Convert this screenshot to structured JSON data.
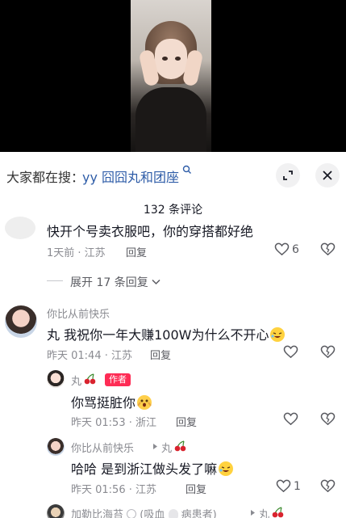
{
  "search": {
    "prefix": "大家都在搜：",
    "query": "yy 囧囧丸和团座"
  },
  "comments_header": {
    "count_label": "132 条评论"
  },
  "comments": [
    {
      "text": "快开个号卖衣服吧，你的穿搭都好绝",
      "meta": "1天前 · 江苏",
      "reply_label": "回复",
      "likes": "6"
    },
    {
      "username": "你比从前快乐",
      "text": "丸 我祝你一年大赚100W为什么不开心",
      "meta": "昨天 01:44 · 江苏",
      "reply_label": "回复"
    }
  ],
  "expand_replies": "展开 17 条回复",
  "replies": [
    {
      "username": "丸",
      "badge": "作者",
      "text": "你骂挺脏你",
      "meta": "昨天 01:53 · 浙江",
      "reply_label": "回复"
    },
    {
      "username": "你比从前快乐",
      "reply_to": "丸",
      "text": "哈哈  是到浙江做头发了嘛",
      "meta": "昨天 01:56 · 江苏",
      "reply_label": "回复",
      "likes": "1"
    },
    {
      "username": "加勒比海苔",
      "username_suffix": "(吸血",
      "username_suffix2": "病患者)",
      "reply_to": "丸"
    }
  ],
  "colors": {
    "link_blue": "#2f5da8",
    "author_badge": "#fe2c55",
    "meta_gray": "#8a8b91"
  }
}
